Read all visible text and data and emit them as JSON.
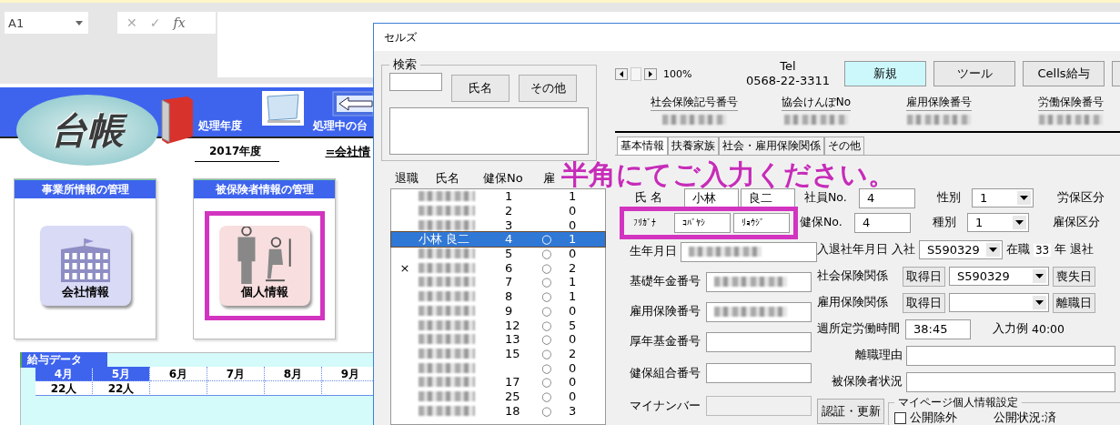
{
  "excel": {
    "name_box": "A1",
    "formula_bar": {
      "cancel": "✕",
      "enter": "✓",
      "function": "fx"
    },
    "banner": {
      "logo": "台帳",
      "year_label": "処理年度",
      "year": "2017年度",
      "current_label": "処理中の台",
      "current": "=会社情"
    },
    "cards": [
      {
        "header": "事業所情報の管理",
        "tile": "会社情報",
        "kind": "company",
        "highlighted": false
      },
      {
        "header": "被保険者情報の管理",
        "tile": "個人情報",
        "kind": "person",
        "highlighted": true
      }
    ],
    "salary": {
      "tab": "給与データ",
      "months": [
        {
          "label": "4月",
          "value": "22人",
          "highlighted": true
        },
        {
          "label": "5月",
          "value": "22人",
          "highlighted": true
        },
        {
          "label": "6月",
          "highlighted": false
        },
        {
          "label": "7月",
          "highlighted": false
        },
        {
          "label": "8月",
          "highlighted": false
        },
        {
          "label": "9月",
          "highlighted": false
        }
      ]
    }
  },
  "dialog": {
    "title": "セルズ",
    "search": {
      "legend": "検索",
      "buttons": [
        "氏名",
        "その他"
      ]
    },
    "list": {
      "columns": [
        "退職",
        "氏名",
        "健保No",
        "雇"
      ],
      "rows": [
        {
          "no": "1",
          "fuyo": "1",
          "selected": false
        },
        {
          "no": "2",
          "fuyo": "0",
          "selected": false
        },
        {
          "no": "3",
          "fuyo": "0",
          "selected": false
        },
        {
          "name": "小林 良二",
          "no": "4",
          "koyo": "○",
          "fuyo": "1",
          "selected": true
        },
        {
          "no": "5",
          "koyo": "○",
          "fuyo": "0",
          "selected": false
        },
        {
          "retire": "×",
          "no": "6",
          "koyo": "○",
          "fuyo": "2",
          "selected": false
        },
        {
          "no": "7",
          "koyo": "○",
          "fuyo": "1",
          "selected": false
        },
        {
          "no": "8",
          "koyo": "○",
          "fuyo": "1",
          "selected": false
        },
        {
          "no": "9",
          "koyo": "○",
          "fuyo": "0",
          "selected": false
        },
        {
          "no": "12",
          "koyo": "○",
          "fuyo": "5",
          "selected": false
        },
        {
          "no": "13",
          "koyo": "○",
          "fuyo": "0",
          "selected": false
        },
        {
          "no": "15",
          "koyo": "○",
          "fuyo": "2",
          "selected": false
        },
        {
          "koyo": "○",
          "fuyo": "0",
          "selected": false
        },
        {
          "no": "17",
          "koyo": "○",
          "fuyo": "0",
          "selected": false
        },
        {
          "no": "25",
          "koyo": "○",
          "fuyo": "0",
          "selected": false
        },
        {
          "no": "18",
          "koyo": "○",
          "fuyo": "3",
          "selected": false
        }
      ]
    },
    "zoom": {
      "reading": "100%"
    },
    "tel": {
      "label": "Tel",
      "number": "0568-22-3311"
    },
    "buttons": [
      {
        "label": "新規",
        "highlighted": true
      },
      {
        "label": "ツール",
        "highlighted": false
      },
      {
        "label": "Cells給与",
        "highlighted": false
      }
    ],
    "info": [
      "社会保険記号番号",
      "協会けんぽNo",
      "雇用保険番号",
      "労働保険番号"
    ],
    "tabs": [
      {
        "label": "基本情報",
        "selected": true
      },
      {
        "label": "扶養家族",
        "selected": false
      },
      {
        "label": "社会・雇用保険関係",
        "selected": false
      },
      {
        "label": "その他",
        "selected": false
      }
    ],
    "name_row": {
      "label": "氏 名",
      "family": "小林",
      "given": "良二"
    },
    "kana_row": {
      "label": "ﾌﾘｶﾞﾅ",
      "family": "ｺﾊﾞﾔｼ",
      "given": "ﾘｮｳｼﾞ",
      "highlighted": true
    },
    "ids": [
      {
        "label": "社員No.",
        "value": "4"
      },
      {
        "label": "健保No.",
        "value": "4"
      }
    ],
    "selects": [
      {
        "label": "性別",
        "value": "1",
        "side_label": "労保区分"
      },
      {
        "label": "種別",
        "value": "1",
        "side_label": "雇保区分"
      }
    ],
    "left_fields": [
      {
        "label": "生年月日",
        "blurred": true,
        "disabled": false
      },
      {
        "label": "基礎年金番号",
        "blurred": true,
        "disabled": false
      },
      {
        "label": "雇用保険番号",
        "blurred": true,
        "disabled": false
      },
      {
        "label": "厚年基金番号",
        "blurred": false,
        "disabled": false
      },
      {
        "label": "健保組合番号",
        "blurred": false,
        "disabled": false
      },
      {
        "label": "マイナンバー",
        "blurred": false,
        "disabled": true
      }
    ],
    "hire": {
      "label": "入退社年月日 入社",
      "value": "S590329",
      "tenure_label": "在職",
      "tenure": "33",
      "tenure_unit": "年",
      "retire_label": "退社"
    },
    "insurance": [
      {
        "label": "社会保険関係",
        "button": "取得日",
        "value": "S590329",
        "end_button": "喪失日"
      },
      {
        "label": "雇用保険関係",
        "button": "取得日",
        "end_button": "離職日"
      }
    ],
    "hours": {
      "label": "週所定労働時間",
      "value": "38:45",
      "example_label": "入力例",
      "example": "40:00"
    },
    "text_fields": [
      "離職理由",
      "被保険者状況"
    ],
    "auth_button": "認証・更新",
    "mypage": {
      "legend": "マイページ個人情報設定",
      "checkbox": {
        "label": "公開除外",
        "checked": false
      },
      "status": "公開状況:済"
    },
    "notice": "半角にてご入力ください。"
  }
}
